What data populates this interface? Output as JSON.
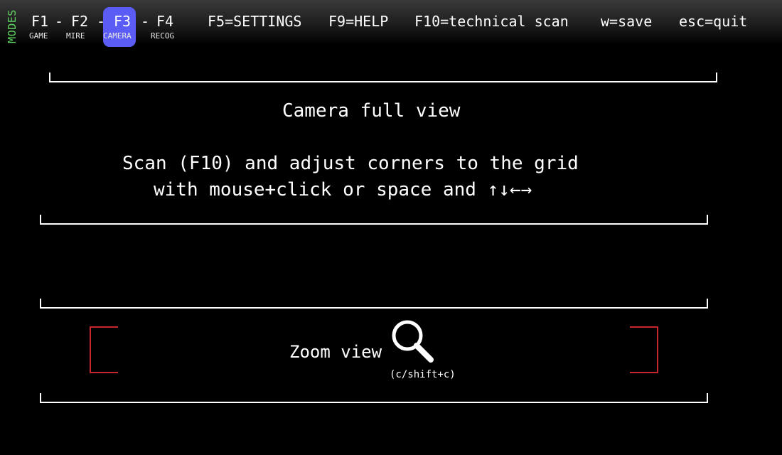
{
  "topbar": {
    "modes_label": "MODES",
    "modes": [
      {
        "key": "F1",
        "label": "GAME"
      },
      {
        "key": "F2",
        "label": "MIRE"
      },
      {
        "key": "F3",
        "label": "CAMERA",
        "active": true
      },
      {
        "key": "F4",
        "label": "RECOG"
      }
    ],
    "separator": "-",
    "commands": {
      "settings": "F5=SETTINGS",
      "help": "F9=HELP",
      "scan": "F10=technical scan",
      "save": "w=save",
      "quit": "esc=quit"
    },
    "colors": {
      "active_mode": "#5b5bf5",
      "modes_label": "#5fd35f"
    }
  },
  "camera_panel": {
    "title": "Camera full view",
    "instruction_line1": "Scan (F10) and adjust corners to the grid",
    "instruction_line2": "with mouse+click or space and ↑↓←→"
  },
  "zoom_panel": {
    "title": "Zoom view",
    "icon": "magnifier-icon",
    "hint": "(c/shift+c)",
    "corner_color": "#c8262c"
  }
}
